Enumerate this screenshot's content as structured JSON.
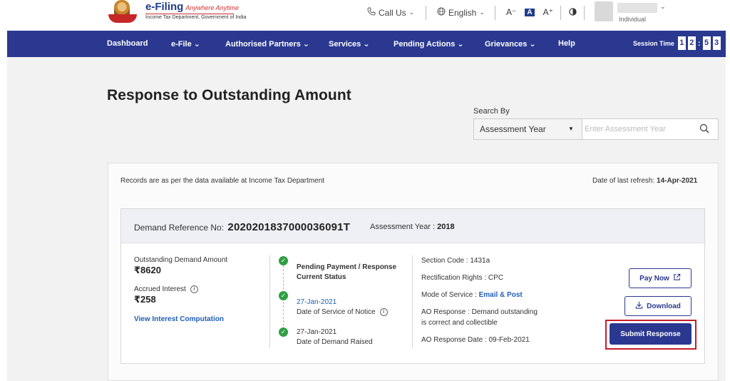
{
  "brand": {
    "title": "e-Filing",
    "tagline": "Anywhere Anytime",
    "subtitle": "Income Tax Department, Government of India"
  },
  "header": {
    "call_us": "Call Us",
    "language": "English",
    "font_decrease": "A⁻",
    "font_default": "A",
    "font_increase": "A⁺",
    "contrast_icon": "contrast-icon",
    "user_role": "Individual"
  },
  "nav": {
    "items": [
      {
        "label": "Dashboard"
      },
      {
        "label": "e-File"
      },
      {
        "label": "Authorised Partners"
      },
      {
        "label": "Services"
      },
      {
        "label": "Pending Actions"
      },
      {
        "label": "Grievances"
      },
      {
        "label": "Help"
      }
    ],
    "session_label": "Session Time",
    "session_digits": [
      "1",
      "2",
      "5",
      "3"
    ]
  },
  "page": {
    "title": "Response to Outstanding Amount",
    "search_label": "Search By",
    "search_select": "Assessment Year",
    "search_placeholder": "Enter Assessment Year"
  },
  "records": {
    "note": "Records are as per the data available at Income Tax Department",
    "refresh_label": "Date of last refresh:",
    "refresh_date": "14-Apr-2021"
  },
  "demand": {
    "ref_label": "Demand Reference No:",
    "ref_number": "2020201837000036091T",
    "ay_label": "Assessment Year :",
    "ay_value": "2018",
    "outstanding_label": "Outstanding Demand Amount",
    "outstanding_value": "₹8620",
    "interest_label": "Accrued Interest",
    "interest_value": "₹258",
    "view_interest_link": "View Interest Computation",
    "timeline": {
      "status_title_1": "Pending Payment / Response",
      "status_title_2": "Current Status",
      "notice_date": "27-Jan-2021",
      "notice_label": "Date of Service of Notice",
      "raised_date": "27-Jan-2021",
      "raised_label": "Date of Demand Raised"
    },
    "section_code": "Section Code : 1431a",
    "rectification": "Rectification Rights : CPC",
    "mode_label": "Mode of Service :",
    "mode_value": "Email & Post",
    "ao_response_1": "AO Response : Demand outstanding",
    "ao_response_2": "is correct and collectible",
    "ao_response_date": "AO Response Date : 09-Feb-2021"
  },
  "actions": {
    "pay_now": "Pay Now",
    "download": "Download",
    "submit_response": "Submit Response"
  },
  "colors": {
    "nav_bg": "#2a3890",
    "link": "#1f5fb5",
    "highlight": "#c41e2a",
    "success": "#2e9e44"
  }
}
